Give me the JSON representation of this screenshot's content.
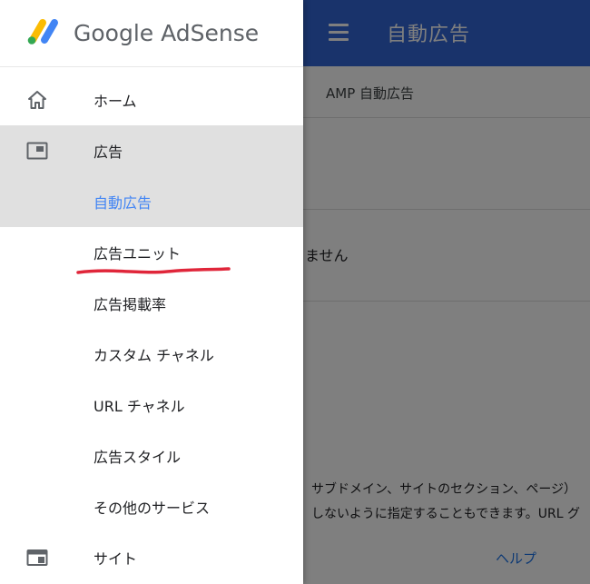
{
  "app": {
    "brand": "Google AdSense",
    "page_title": "自動広告",
    "tab": "AMP 自動広告",
    "card_text": "りません",
    "description_line1": "サブドメイン、サイトのセクション、ページ）",
    "description_line2": "しないように指定することもできます。URL グ",
    "help_link": "ヘルプ"
  },
  "drawer": {
    "items": [
      {
        "label": "ホーム",
        "icon": "home-icon"
      },
      {
        "label": "広告",
        "icon": "ads-icon"
      },
      {
        "label": "自動広告"
      },
      {
        "label": "広告ユニット"
      },
      {
        "label": "広告掲載率"
      },
      {
        "label": "カスタム チャネル"
      },
      {
        "label": "URL チャネル"
      },
      {
        "label": "広告スタイル"
      },
      {
        "label": "その他のサービス"
      },
      {
        "label": "サイト",
        "icon": "sites-icon"
      }
    ]
  },
  "colors": {
    "top_bar": "#3367d6",
    "selected_text": "#4285f4",
    "active_background": "#e0e0e0",
    "annotation_underline": "#e0263a"
  }
}
